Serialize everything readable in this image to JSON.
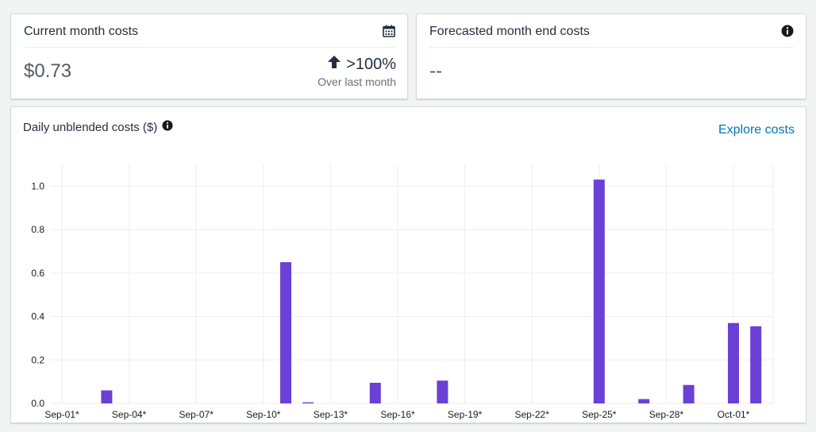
{
  "current": {
    "title": "Current month costs",
    "value": "$0.73",
    "trend": ">100%",
    "trend_sub": "Over last month",
    "icon": "calendar-icon",
    "trend_icon": "arrow-up-icon"
  },
  "forecast": {
    "title": "Forecasted month end costs",
    "value": "--",
    "icon": "info-icon"
  },
  "chart": {
    "title": "Daily unblended costs ($)",
    "info_icon": "info-icon",
    "explore_label": "Explore costs"
  },
  "colors": {
    "bar": "#6b40d6",
    "link": "#0073bb"
  },
  "chart_data": {
    "type": "bar",
    "title": "Daily unblended costs ($)",
    "xlabel": "",
    "ylabel": "",
    "ylim": [
      0,
      1.0
    ],
    "yticks": [
      "0.0",
      "0.2",
      "0.4",
      "0.6",
      "0.8",
      "1.0"
    ],
    "xticks": [
      "Sep-01*",
      "Sep-04*",
      "Sep-07*",
      "Sep-10*",
      "Sep-13*",
      "Sep-16*",
      "Sep-19*",
      "Sep-22*",
      "Sep-25*",
      "Sep-28*",
      "Oct-01*"
    ],
    "grid": true,
    "categories": [
      "Sep-01*",
      "Sep-02*",
      "Sep-03*",
      "Sep-04*",
      "Sep-05*",
      "Sep-06*",
      "Sep-07*",
      "Sep-08*",
      "Sep-09*",
      "Sep-10*",
      "Sep-11*",
      "Sep-12*",
      "Sep-13*",
      "Sep-14*",
      "Sep-15*",
      "Sep-16*",
      "Sep-17*",
      "Sep-18*",
      "Sep-19*",
      "Sep-20*",
      "Sep-21*",
      "Sep-22*",
      "Sep-23*",
      "Sep-24*",
      "Sep-25*",
      "Sep-26*",
      "Sep-27*",
      "Sep-28*",
      "Sep-29*",
      "Sep-30*",
      "Oct-01*",
      "Oct-02*"
    ],
    "values": [
      0,
      0,
      0.06,
      0,
      0,
      0,
      0,
      0,
      0,
      0,
      0.65,
      0.005,
      0,
      0,
      0.095,
      0,
      0,
      0.105,
      0,
      0,
      0,
      0,
      0,
      0,
      1.03,
      0,
      0.02,
      0,
      0.085,
      0,
      0.37,
      0.355
    ]
  }
}
